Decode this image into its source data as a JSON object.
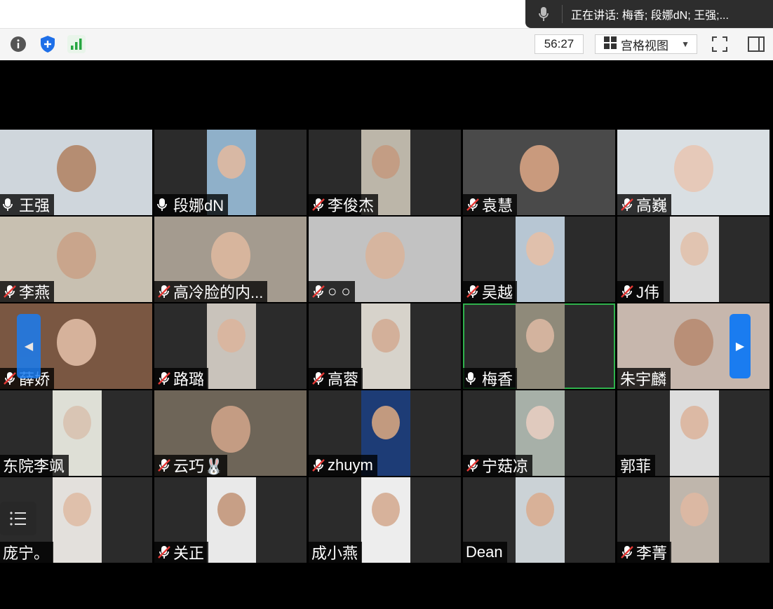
{
  "speaking": {
    "text": "正在讲话: 梅香; 段娜dN; 王强;..."
  },
  "toolbar": {
    "timer": "56:27",
    "view_label": "宫格视图"
  },
  "participants": [
    {
      "name": "王强",
      "mic": "on",
      "bg": "#cfd6dc",
      "face": "#b58d72"
    },
    {
      "name": "段娜dN",
      "mic": "on",
      "bg": "#8fb0c9",
      "face": "#d8b8a4"
    },
    {
      "name": "李俊杰",
      "mic": "muted",
      "bg": "#bcb6a9",
      "face": "#c39d84"
    },
    {
      "name": "袁慧",
      "mic": "muted",
      "bg": "#4a4a4a",
      "face": "#c99a7d"
    },
    {
      "name": "高巍",
      "mic": "muted",
      "bg": "#d9dfe3",
      "face": "#e6c9b9"
    },
    {
      "name": "李燕",
      "mic": "muted",
      "bg": "#c8c0b1",
      "face": "#c9a58c"
    },
    {
      "name": "高冷脸的内...",
      "mic": "muted",
      "bg": "#a49b8f",
      "face": "#d7b59d"
    },
    {
      "name": "○ ○",
      "mic": "muted",
      "bg": "#c2c2c2",
      "face": "#d6b59f"
    },
    {
      "name": "吴越",
      "mic": "muted",
      "bg": "#b7c6d3",
      "face": "#e0c0ac"
    },
    {
      "name": "J伟",
      "mic": "muted",
      "bg": "#dcdcdc",
      "face": "#e1c4b1"
    },
    {
      "name": "薛娇",
      "mic": "muted",
      "bg": "#7a5742",
      "face": "#d6b29b"
    },
    {
      "name": "路璐",
      "mic": "muted",
      "bg": "#c9c3bb",
      "face": "#d9b6a0"
    },
    {
      "name": "高蓉",
      "mic": "muted",
      "bg": "#d7d3cb",
      "face": "#d3b09a"
    },
    {
      "name": "梅香",
      "mic": "on",
      "bg": "#8f8a7a",
      "face": "#d3b39e"
    },
    {
      "name": "朱宇麟",
      "mic": "none",
      "bg": "#c7b7ad",
      "face": "#b98f77"
    },
    {
      "name": "东院李飒",
      "mic": "none",
      "bg": "#dedfd6",
      "face": "#d9c5b4"
    },
    {
      "name": "云巧🐰",
      "mic": "muted",
      "bg": "#6e6558",
      "face": "#c49c83"
    },
    {
      "name": "zhuym",
      "mic": "muted",
      "bg": "#1d3c76",
      "face": "#c29a7f"
    },
    {
      "name": "宁菇凉",
      "mic": "muted",
      "bg": "#a7b0a8",
      "face": "#e0cabe"
    },
    {
      "name": "郭菲",
      "mic": "none",
      "bg": "#dddddd",
      "face": "#dcb9a4"
    },
    {
      "name": "庞宁。",
      "mic": "none",
      "bg": "#e3e0dc",
      "face": "#dfc0ab"
    },
    {
      "name": "关正",
      "mic": "muted",
      "bg": "#e9e9e9",
      "face": "#c79f86"
    },
    {
      "name": "成小燕",
      "mic": "none",
      "bg": "#ededed",
      "face": "#d7b29b"
    },
    {
      "name": "Dean",
      "mic": "none",
      "bg": "#cbd2d6",
      "face": "#d8b198"
    },
    {
      "name": "李菁",
      "mic": "muted",
      "bg": "#bfb6ac",
      "face": "#dbb8a3"
    }
  ]
}
